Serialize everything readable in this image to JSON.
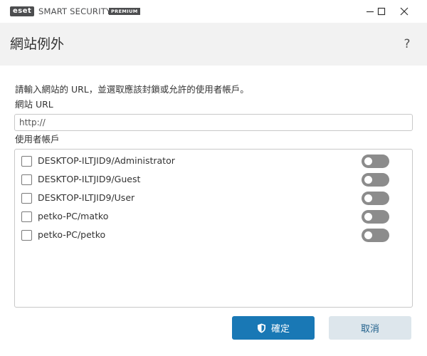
{
  "window": {
    "logo_text": "eset",
    "product_name": "SMART SECURITY",
    "edition": "PREMIUM"
  },
  "header": {
    "title": "網站例外",
    "help_symbol": "?"
  },
  "form": {
    "instruction": "請輸入網站的 URL，並選取應該封鎖或允許的使用者帳戶。",
    "url_label": "網站 URL",
    "url_placeholder": "http://",
    "url_value": "",
    "users_label": "使用者帳戶",
    "users": [
      {
        "name": "DESKTOP-ILTJID9/Administrator",
        "checked": false,
        "toggle_on": false
      },
      {
        "name": "DESKTOP-ILTJID9/Guest",
        "checked": false,
        "toggle_on": false
      },
      {
        "name": "DESKTOP-ILTJID9/User",
        "checked": false,
        "toggle_on": false
      },
      {
        "name": "petko-PC/matko",
        "checked": false,
        "toggle_on": false
      },
      {
        "name": "petko-PC/petko",
        "checked": false,
        "toggle_on": false
      }
    ]
  },
  "buttons": {
    "ok_label": "確定",
    "cancel_label": "取消"
  },
  "colors": {
    "primary": "#1978b5",
    "secondary": "#dde6ec",
    "toggle_off": "#8c8c8c",
    "header_bg": "#f2f2f2"
  }
}
